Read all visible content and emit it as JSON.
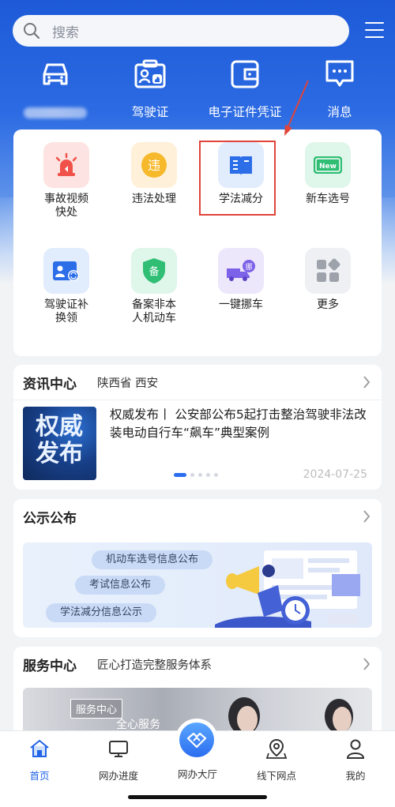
{
  "search": {
    "placeholder": "搜索"
  },
  "quick": [
    {
      "icon": "car-icon",
      "label": ""
    },
    {
      "icon": "drivers-license-icon",
      "label": "驾驶证"
    },
    {
      "icon": "wallet-icon",
      "label": "电子证件凭证"
    },
    {
      "icon": "message-icon",
      "label": "消息"
    }
  ],
  "grid": [
    {
      "icon": "siren-icon",
      "label": "事故视频\n快处"
    },
    {
      "icon": "violation-icon",
      "label": "违法处理",
      "glyph": "违"
    },
    {
      "icon": "book-icon",
      "label": "学法减分"
    },
    {
      "icon": "new-plate-icon",
      "label": "新车选号",
      "glyph": "New"
    },
    {
      "icon": "license-replace-icon",
      "label": "驾驶证补\n换领"
    },
    {
      "icon": "shield-record-icon",
      "label": "备案非本\n人机动车",
      "glyph": "备"
    },
    {
      "icon": "tow-truck-icon",
      "label": "一键挪车",
      "glyph": "挪"
    },
    {
      "icon": "more-grid-icon",
      "label": "更多"
    }
  ],
  "news": {
    "title": "资讯中心",
    "location": "陕西省 西安",
    "thumb": [
      "权威",
      "发布"
    ],
    "headline": "权威发布丨 公安部公布5起打击整治驾驶非法改装电动自行车“飙车”典型案例",
    "date": "2024-07-25",
    "page_count": 5,
    "active_page": 1
  },
  "public": {
    "title": "公示公布",
    "pills": [
      "机动车选号信息公布",
      "考试信息公布",
      "学法减分信息公示"
    ]
  },
  "service": {
    "title": "服务中心",
    "subtitle": "匠心打造完整服务体系",
    "tag": "服务中心",
    "tag2": "全心服务"
  },
  "tabs": [
    {
      "icon": "home-icon",
      "label": "首页",
      "active": true
    },
    {
      "icon": "monitor-icon",
      "label": "网办进度"
    },
    {
      "icon": "handshake-icon",
      "label": "网办大厅"
    },
    {
      "icon": "map-pin-icon",
      "label": "线下网点"
    },
    {
      "icon": "user-icon",
      "label": "我的"
    }
  ],
  "colors": {
    "primary": "#2364e6",
    "highlight_red": "#e0443b"
  }
}
